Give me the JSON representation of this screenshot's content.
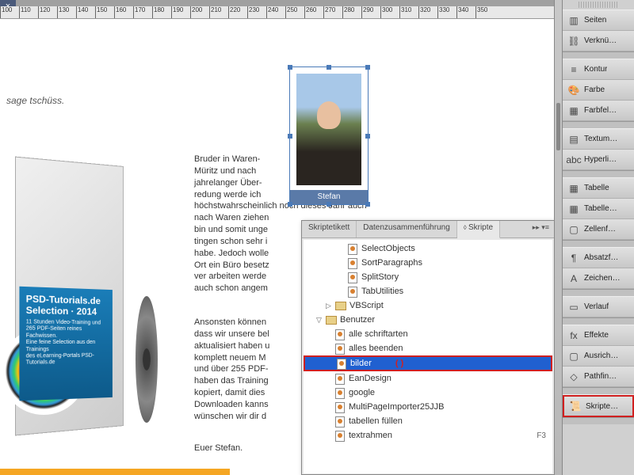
{
  "ruler": {
    "start": 100,
    "step": 10,
    "count": 26
  },
  "page": {
    "tagline": "sage tschüss.",
    "body1": "Bruder in Waren-\nMüritz und nach\njahrelanger Über-\nredung werde ich\nhöchstwahrscheinlich noch dieses Jahr auch\nnach Waren ziehen\nbin und somit unge\ntingen schon sehr i\nhabe. Jedoch wolle\nOrt ein Büro besetz\nver arbeiten werde\nauch schon angem",
    "body2": "Ansonsten können\ndass wir unsere bel\naktualisiert haben u\nkomplett neuem M\nund über 255 PDF-\nhaben das Training\nkopiert, damit dies\nDownloaden kanns\nwünschen wir dir d",
    "signoff": "Euer  Stefan.",
    "photo_caption": "Stefan"
  },
  "dvd": {
    "title": "PSD-Tutorials.de\nSelection · 2014",
    "sub1": "11 Stunden Video-Training und",
    "sub2": "265 PDF-Seiten reines Fachwissen.",
    "sub3": "Eine feine Selection aus den Trainings",
    "sub4": "des eLearning-Portals PSD-Tutorials.de"
  },
  "scripts_panel": {
    "tabs": [
      "Skriptetikett",
      "Datenzusammenführung",
      "Skripte"
    ],
    "active_tab": 2,
    "tree": [
      {
        "type": "script",
        "depth": 3,
        "label": "SelectObjects"
      },
      {
        "type": "script",
        "depth": 3,
        "label": "SortParagraphs"
      },
      {
        "type": "script",
        "depth": 3,
        "label": "SplitStory"
      },
      {
        "type": "script",
        "depth": 3,
        "label": "TabUtilities"
      },
      {
        "type": "folder",
        "depth": 2,
        "label": "VBScript",
        "toggle": "▷"
      },
      {
        "type": "folder",
        "depth": 1,
        "label": "Benutzer",
        "toggle": "▽"
      },
      {
        "type": "script",
        "depth": 2,
        "label": "alle schriftarten"
      },
      {
        "type": "script",
        "depth": 2,
        "label": "alles beenden"
      },
      {
        "type": "script",
        "depth": 2,
        "label": "bilder",
        "selected": true,
        "cursor": "(  )"
      },
      {
        "type": "script",
        "depth": 2,
        "label": "EanDesign"
      },
      {
        "type": "script",
        "depth": 2,
        "label": "google"
      },
      {
        "type": "script",
        "depth": 2,
        "label": "MultiPageImporter25JJB"
      },
      {
        "type": "script",
        "depth": 2,
        "label": "tabellen füllen"
      },
      {
        "type": "script",
        "depth": 2,
        "label": "textrahmen",
        "shortcut": "F3"
      }
    ]
  },
  "dock": [
    [
      {
        "icon": "▥",
        "label": "Seiten",
        "name": "pages"
      },
      {
        "icon": "⛓",
        "label": "Verknü…",
        "name": "links"
      }
    ],
    [
      {
        "icon": "≡",
        "label": "Kontur",
        "name": "stroke"
      },
      {
        "icon": "🎨",
        "label": "Farbe",
        "name": "color"
      },
      {
        "icon": "▦",
        "label": "Farbfel…",
        "name": "swatches"
      }
    ],
    [
      {
        "icon": "▤",
        "label": "Textum…",
        "name": "text-wrap"
      },
      {
        "icon": "abc",
        "label": "Hyperli…",
        "name": "hyperlinks"
      }
    ],
    [
      {
        "icon": "▦",
        "label": "Tabelle",
        "name": "table"
      },
      {
        "icon": "▦",
        "label": "Tabelle…",
        "name": "table-styles"
      },
      {
        "icon": "▢",
        "label": "Zellenf…",
        "name": "cell-styles"
      }
    ],
    [
      {
        "icon": "¶",
        "label": "Absatzf…",
        "name": "paragraph-styles"
      },
      {
        "icon": "A",
        "label": "Zeichen…",
        "name": "character-styles"
      }
    ],
    [
      {
        "icon": "▭",
        "label": "Verlauf",
        "name": "gradient"
      }
    ],
    [
      {
        "icon": "fx",
        "label": "Effekte",
        "name": "effects"
      },
      {
        "icon": "▢",
        "label": "Ausrich…",
        "name": "align"
      },
      {
        "icon": "◇",
        "label": "Pathfin…",
        "name": "pathfinder"
      }
    ],
    [
      {
        "icon": "📜",
        "label": "Skripte…",
        "name": "scripts",
        "highlighted": true
      }
    ]
  ]
}
